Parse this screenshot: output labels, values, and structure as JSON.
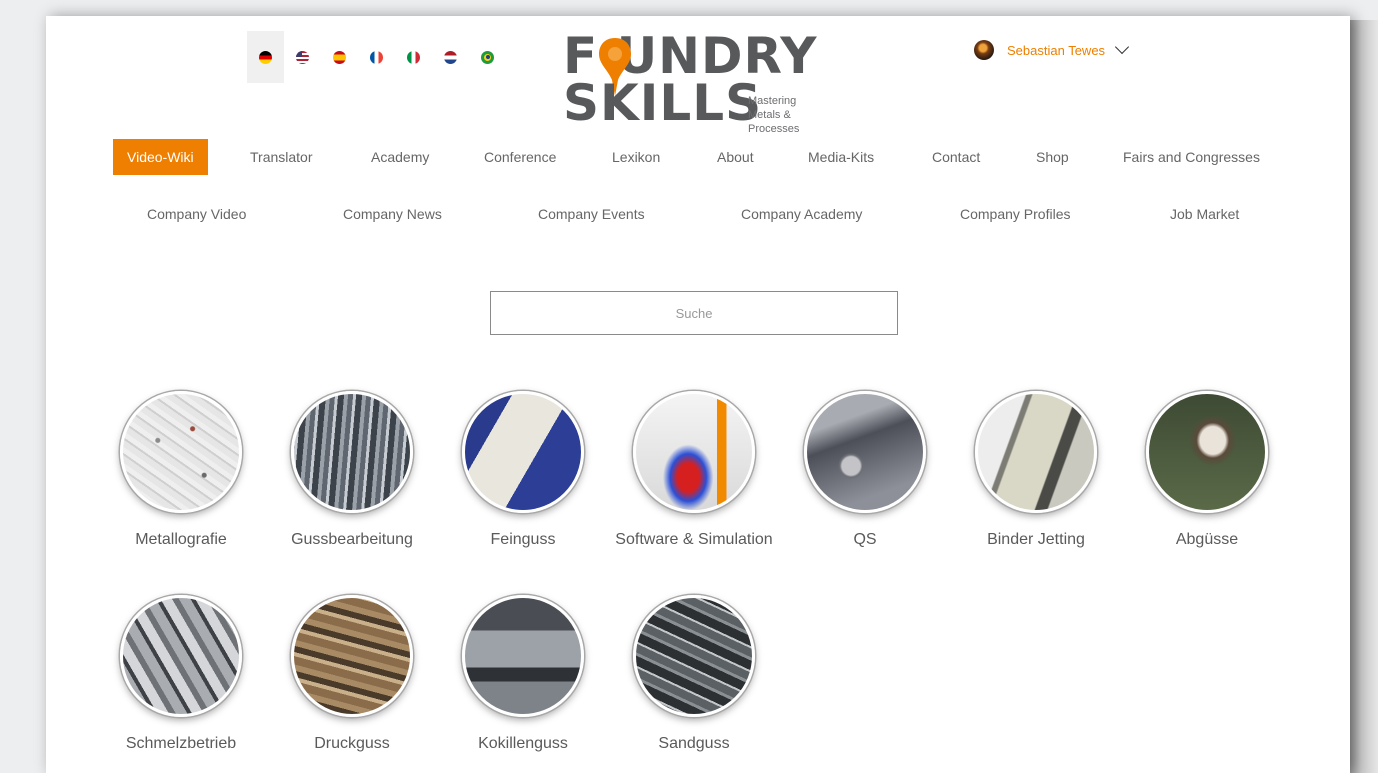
{
  "languages": [
    {
      "code": "de",
      "icon": "germany-flag-icon",
      "active": true
    },
    {
      "code": "en",
      "icon": "usa-flag-icon",
      "active": false
    },
    {
      "code": "es",
      "icon": "spain-flag-icon",
      "active": false
    },
    {
      "code": "fr",
      "icon": "france-flag-icon",
      "active": false
    },
    {
      "code": "it",
      "icon": "italy-flag-icon",
      "active": false
    },
    {
      "code": "nl",
      "icon": "netherlands-flag-icon",
      "active": false
    },
    {
      "code": "br",
      "icon": "brazil-flag-icon",
      "active": false
    }
  ],
  "logo": {
    "line1": "F UNDRY",
    "line2": "SKILLS",
    "tagline": [
      "Mastering",
      "Metals &",
      "Processes"
    ]
  },
  "user": {
    "name": "Sebastian Tewes",
    "avatar_icon": "avatar-icon",
    "menu_icon": "chevron-down-icon"
  },
  "colors": {
    "accent": "#ee7f00",
    "text": "#666666",
    "logo_gray": "#58595b"
  },
  "nav": {
    "items": [
      "Video-Wiki",
      "Translator",
      "Academy",
      "Conference",
      "Lexikon",
      "About",
      "Media-Kits",
      "Contact",
      "Shop",
      "Fairs and Congresses"
    ],
    "active": "Video-Wiki"
  },
  "subnav": {
    "items": [
      "Company Video",
      "Company News",
      "Company Events",
      "Company Academy",
      "Company Profiles",
      "Job Market"
    ]
  },
  "search": {
    "placeholder": "Suche"
  },
  "categories": [
    {
      "label": "Metallografie"
    },
    {
      "label": "Gussbearbeitung"
    },
    {
      "label": "Feinguss"
    },
    {
      "label": "Software & Simulation"
    },
    {
      "label": "QS"
    },
    {
      "label": "Binder Jetting"
    },
    {
      "label": "Abgüsse"
    },
    {
      "label": "Schmelzbetrieb"
    },
    {
      "label": "Druckguss"
    },
    {
      "label": "Kokillenguss"
    },
    {
      "label": "Sandguss"
    }
  ]
}
